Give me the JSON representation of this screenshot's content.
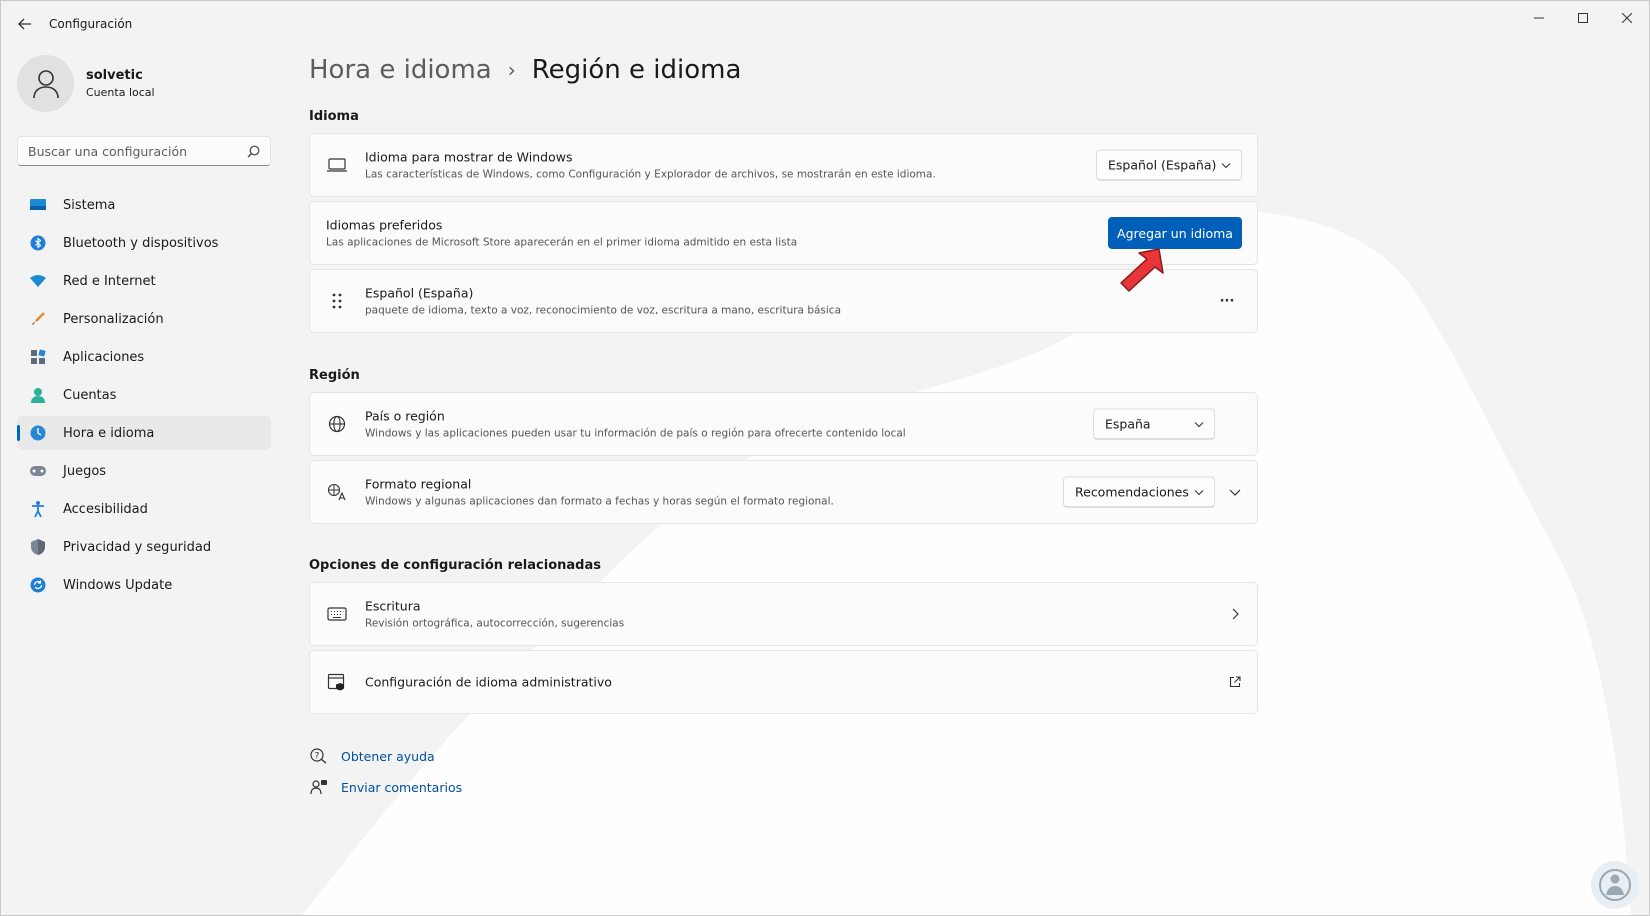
{
  "window": {
    "title": "Configuración"
  },
  "profile": {
    "name": "solvetic",
    "account": "Cuenta local"
  },
  "search": {
    "placeholder": "Buscar una configuración"
  },
  "sidebar": {
    "items": [
      {
        "label": "Sistema",
        "icon": "system-icon",
        "active": false
      },
      {
        "label": "Bluetooth y dispositivos",
        "icon": "bluetooth-icon",
        "active": false
      },
      {
        "label": "Red e Internet",
        "icon": "wifi-icon",
        "active": false
      },
      {
        "label": "Personalización",
        "icon": "brush-icon",
        "active": false
      },
      {
        "label": "Aplicaciones",
        "icon": "apps-icon",
        "active": false
      },
      {
        "label": "Cuentas",
        "icon": "accounts-icon",
        "active": false
      },
      {
        "label": "Hora e idioma",
        "icon": "time-language-icon",
        "active": true
      },
      {
        "label": "Juegos",
        "icon": "gamepad-icon",
        "active": false
      },
      {
        "label": "Accesibilidad",
        "icon": "accessibility-icon",
        "active": false
      },
      {
        "label": "Privacidad y seguridad",
        "icon": "shield-icon",
        "active": false
      },
      {
        "label": "Windows Update",
        "icon": "update-icon",
        "active": false
      }
    ]
  },
  "breadcrumb": {
    "parent": "Hora e idioma",
    "separator": "›",
    "current": "Región e idioma"
  },
  "sections": {
    "language": "Idioma",
    "region": "Región",
    "related": "Opciones de configuración relacionadas"
  },
  "language": {
    "display": {
      "title": "Idioma para mostrar de Windows",
      "desc": "Las características de Windows, como Configuración y Explorador de archivos, se mostrarán en este idioma.",
      "value": "Español (España)"
    },
    "preferred": {
      "title": "Idiomas preferidos",
      "desc": "Las aplicaciones de Microsoft Store aparecerán en el primer idioma admitido en esta lista",
      "button": "Agregar un idioma"
    },
    "installed": {
      "title": "Español (España)",
      "desc": "paquete de idioma, texto a voz, reconocimiento de voz, escritura a mano, escritura básica",
      "more": "···"
    }
  },
  "region": {
    "country": {
      "title": "País o región",
      "desc": "Windows y las aplicaciones pueden usar tu información de país o región para ofrecerte contenido local",
      "value": "España"
    },
    "format": {
      "title": "Formato regional",
      "desc": "Windows y algunas aplicaciones dan formato a fechas y horas según el formato regional.",
      "value": "Recomendaciones"
    }
  },
  "related": {
    "typing": {
      "title": "Escritura",
      "desc": "Revisión ortográfica, autocorrección, sugerencias"
    },
    "admin": {
      "title": "Configuración de idioma administrativo"
    }
  },
  "footer": {
    "help": "Obtener ayuda",
    "feedback": "Enviar comentarios"
  },
  "colors": {
    "accent": "#005fb8",
    "arrow": "#e8353a"
  }
}
